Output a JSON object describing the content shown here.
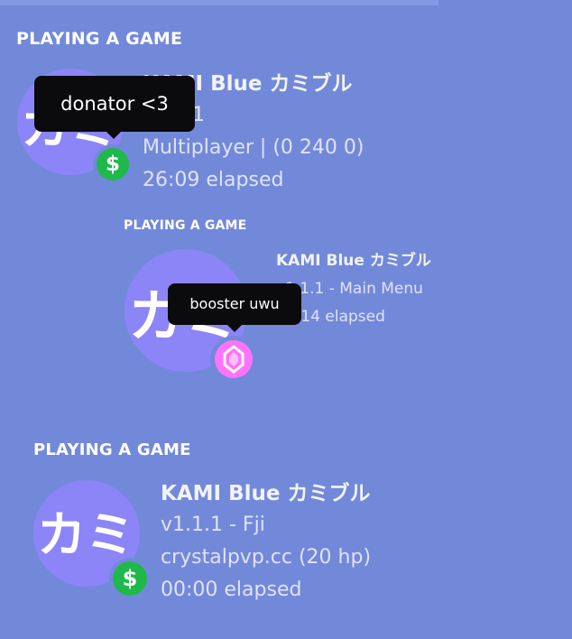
{
  "cards": [
    {
      "heading": "PLAYING A GAME",
      "avatar_text": "カミ",
      "game_title": "KAMI Blue カミブル",
      "details": "v1.1.1",
      "state": "Multiplayer | (0 240 0)",
      "elapsed": "26:09 elapsed",
      "badge_icon": "dollar-icon",
      "tooltip": "donator <3"
    },
    {
      "heading": "PLAYING A GAME",
      "avatar_text": "カミ",
      "game_title": "KAMI Blue カミブル",
      "details": "v1.1.1 - Main Menu",
      "elapsed": "00:14 elapsed",
      "badge_icon": "gem-icon",
      "tooltip": "booster uwu"
    },
    {
      "heading": "PLAYING A GAME",
      "avatar_text": "カミ",
      "game_title": "KAMI Blue カミブル",
      "details": "v1.1.1 - Fji",
      "state": "crystalpvp.cc (20 hp)",
      "elapsed": "00:00 elapsed",
      "badge_icon": "dollar-icon",
      "badge_symbol": "$"
    }
  ],
  "colors": {
    "background": "#7289da",
    "avatar": "#8c85f7",
    "donator_badge": "#1fb84a",
    "booster_badge": "#ff73fa",
    "tooltip_bg": "#0b0b0d"
  }
}
